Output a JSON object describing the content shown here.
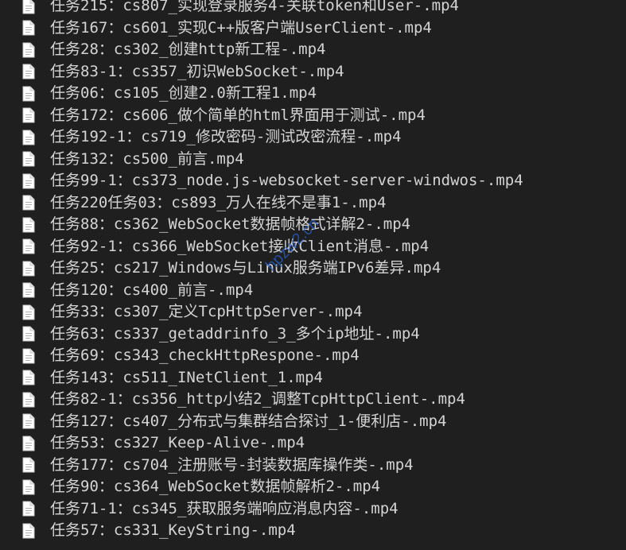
{
  "files": [
    {
      "name": "任务215：cs807_实现登录服务4-关联token和User-.mp4",
      "icon": "video-file-icon"
    },
    {
      "name": "任务167：cs601_实现C++版客户端UserClient-.mp4",
      "icon": "video-file-icon"
    },
    {
      "name": "任务28：cs302_创建http新工程-.mp4",
      "icon": "video-file-icon"
    },
    {
      "name": "任务83-1：cs357_初识WebSocket-.mp4",
      "icon": "video-file-icon"
    },
    {
      "name": "任务06：cs105_创建2.0新工程1.mp4",
      "icon": "video-file-icon"
    },
    {
      "name": "任务172：cs606_做个简单的html界面用于测试-.mp4",
      "icon": "video-file-icon"
    },
    {
      "name": "任务192-1：cs719_修改密码-测试改密流程-.mp4",
      "icon": "video-file-icon"
    },
    {
      "name": "任务132：cs500_前言.mp4",
      "icon": "video-file-icon"
    },
    {
      "name": "任务99-1：cs373_node.js-websocket-server-windwos-.mp4",
      "icon": "video-file-icon"
    },
    {
      "name": "任务220任务03：cs893_万人在线不是事1-.mp4",
      "icon": "video-file-icon"
    },
    {
      "name": "任务88：cs362_WebSocket数据帧格式详解2-.mp4",
      "icon": "video-file-icon"
    },
    {
      "name": "任务92-1：cs366_WebSocket接收Client消息-.mp4",
      "icon": "video-file-icon"
    },
    {
      "name": "任务25：cs217_Windows与Linux服务端IPv6差异.mp4",
      "icon": "video-file-icon"
    },
    {
      "name": "任务120：cs400_前言-.mp4",
      "icon": "video-file-icon"
    },
    {
      "name": "任务33：cs307_定义TcpHttpServer-.mp4",
      "icon": "video-file-icon"
    },
    {
      "name": "任务63：cs337_getaddrinfo_3_多个ip地址-.mp4",
      "icon": "video-file-icon"
    },
    {
      "name": "任务69：cs343_checkHttpRespone-.mp4",
      "icon": "video-file-icon"
    },
    {
      "name": "任务143：cs511_INetClient_1.mp4",
      "icon": "video-file-icon"
    },
    {
      "name": "任务82-1：cs356_http小结2_调整TcpHttpClient-.mp4",
      "icon": "video-file-icon"
    },
    {
      "name": "任务127：cs407_分布式与集群结合探讨_1-便利店-.mp4",
      "icon": "video-file-icon"
    },
    {
      "name": "任务53：cs327_Keep-Alive-.mp4",
      "icon": "video-file-icon"
    },
    {
      "name": "任务177：cs704_注册账号-封装数据库操作类-.mp4",
      "icon": "video-file-icon"
    },
    {
      "name": "任务90：cs364_WebSocket数据帧解析2-.mp4",
      "icon": "video-file-icon"
    },
    {
      "name": "任务71-1：cs345_获取服务端响应消息内容-.mp4",
      "icon": "video-file-icon"
    },
    {
      "name": "任务57：cs331_KeyString-.mp4",
      "icon": "video-file-icon"
    }
  ],
  "watermark": "hpzw2.cn"
}
